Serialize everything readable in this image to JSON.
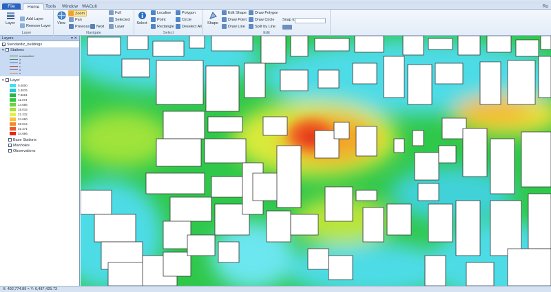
{
  "tabs": {
    "file": "File",
    "items": [
      "Home",
      "Tools",
      "Window",
      "WACult"
    ],
    "right": "Ro"
  },
  "ribbon": {
    "layer_group": {
      "label": "Layer",
      "layer_btn": "Layer",
      "add_layer": "Add Layer",
      "remove_layer": "Remove Layer"
    },
    "navigate_group": {
      "label": "Navigate",
      "view_btn": "View",
      "zoom": "Zoom",
      "pan": "Pan",
      "previous": "Previous",
      "next": "Next",
      "full": "Full",
      "selected": "Selected",
      "layer": "Layer"
    },
    "select_group": {
      "label": "Select",
      "select_btn": "Select",
      "localise": "Localise",
      "polygon": "Polygon",
      "point": "Point",
      "circle": "Circle",
      "rectangle": "Rectangle",
      "deselect_all": "Deselect All"
    },
    "edit_group": {
      "label": "Edit",
      "shape_btn": "Shape",
      "edit_shape": "Edit Shape",
      "draw_point": "Draw Point",
      "draw_line": "Draw Line",
      "draw_polygon": "Draw Polygon",
      "draw_circle": "Draw Circle",
      "split_by_line": "Split by Line",
      "snap_to": "Snap to"
    }
  },
  "panel": {
    "title": "Layers",
    "controls": "▾ ✕",
    "layers": [
      {
        "name": "Stendardiz_buildings",
        "checked": true
      },
      {
        "name": "Stations",
        "checked": true
      }
    ],
    "road_legend": [
      "unclassified",
      "a",
      "b",
      "c",
      "d",
      "e"
    ],
    "road_colors": [
      "#666666",
      "#4b8f4b",
      "#3b6fd0",
      "#c0462e",
      "#8a5db3",
      "#d28e2d"
    ],
    "grid_layer": "Layer",
    "ramp": [
      {
        "label": "0.0000",
        "color": "#3de3f2"
      },
      {
        "label": "3.3076",
        "color": "#26c9d8"
      },
      {
        "label": "7.9661",
        "color": "#1eb84a"
      },
      {
        "label": "11.374",
        "color": "#2fc83a"
      },
      {
        "label": "14.656",
        "color": "#67d83a"
      },
      {
        "label": "18.016",
        "color": "#a8e23c"
      },
      {
        "label": "21.332",
        "color": "#e7ee4a"
      },
      {
        "label": "24.660",
        "color": "#f7c33a"
      },
      {
        "label": "28.014",
        "color": "#f58a2a"
      },
      {
        "label": "31.371",
        "color": "#ee5a22"
      },
      {
        "label": "34.686",
        "color": "#e12a1a"
      }
    ],
    "extra_layers": [
      "Base Stations",
      "Manholes",
      "Observations"
    ]
  },
  "status": {
    "coords": "X: 492,774.89 × Y: 6,487,425.73"
  }
}
